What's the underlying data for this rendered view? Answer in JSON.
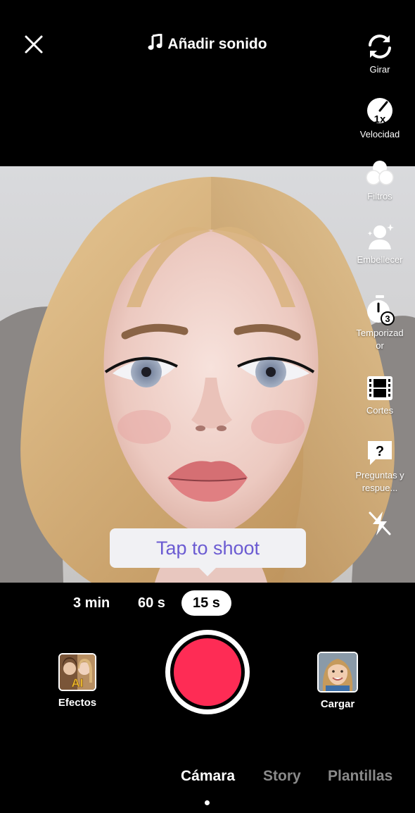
{
  "header": {
    "close_icon": "close-icon",
    "sound_label": "Añadir sonido",
    "sound_icon": "music-note-icon"
  },
  "tools": [
    {
      "id": "flip",
      "label": "Girar",
      "icon": "flip-camera-icon"
    },
    {
      "id": "speed",
      "label": "Velocidad",
      "icon": "speed-icon",
      "badge": "1x"
    },
    {
      "id": "filters",
      "label": "Filtros",
      "icon": "filters-icon"
    },
    {
      "id": "beautify",
      "label": "Embellecer",
      "icon": "beautify-icon"
    },
    {
      "id": "timer",
      "label": "Temporizador",
      "icon": "timer-icon",
      "badge": "3"
    },
    {
      "id": "cuts",
      "label": "Cortes",
      "icon": "film-icon"
    },
    {
      "id": "qa",
      "label": "Preguntas y respue...",
      "icon": "question-bubble-icon"
    },
    {
      "id": "flash",
      "label": "",
      "icon": "flash-off-icon"
    }
  ],
  "tooltip": {
    "text": "Tap to shoot"
  },
  "durations": [
    {
      "label": "3 min",
      "selected": false
    },
    {
      "label": "60 s",
      "selected": false
    },
    {
      "label": "15 s",
      "selected": true
    }
  ],
  "bottom": {
    "effects_label": "Efectos",
    "effects_badge": "AI",
    "upload_label": "Cargar",
    "record_color": "#fe2c55"
  },
  "modes": [
    {
      "label": "Cámara",
      "active": true
    },
    {
      "label": "Story",
      "active": false
    },
    {
      "label": "Plantillas",
      "active": false
    }
  ],
  "colors": {
    "accent": "#fe2c55",
    "tooltip_text": "#6b5bd2",
    "background": "#000000"
  }
}
